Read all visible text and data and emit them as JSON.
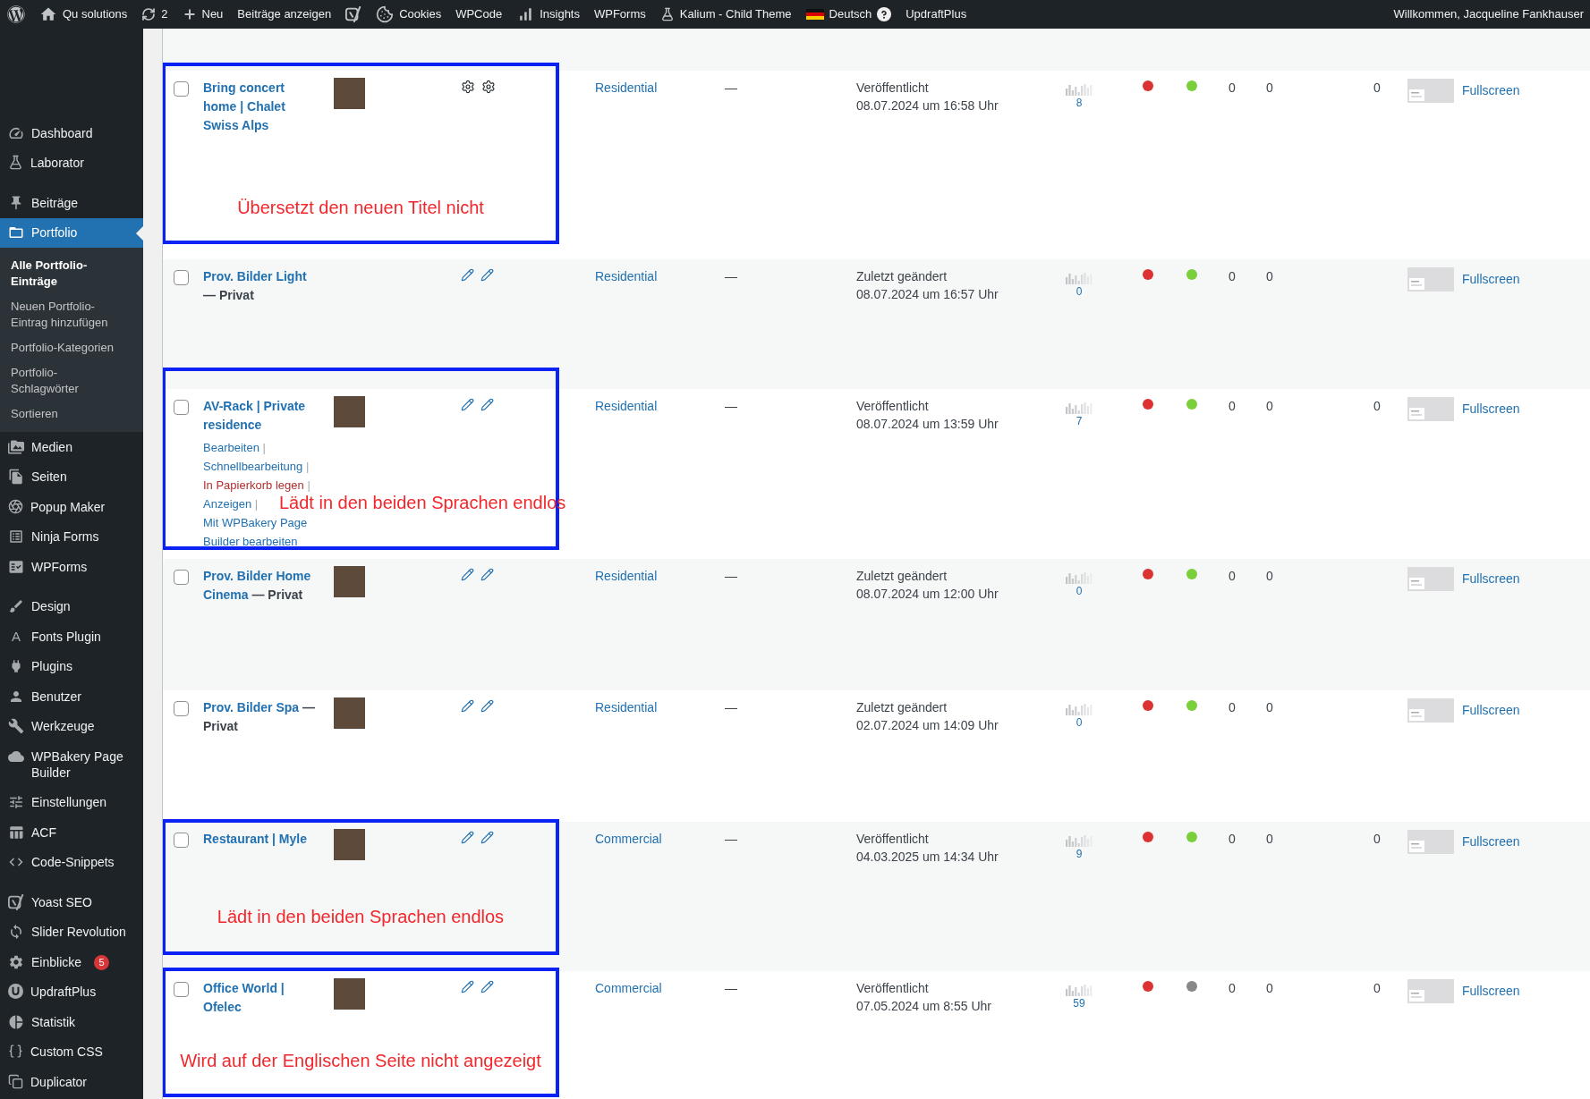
{
  "admin_bar": {
    "items": [
      {
        "kind": "wordpress"
      },
      {
        "kind": "home",
        "label": "Qu solutions"
      },
      {
        "kind": "updates",
        "label": "2"
      },
      {
        "kind": "new",
        "label": "Neu"
      },
      {
        "kind": "text",
        "label": "Beiträge anzeigen"
      },
      {
        "kind": "yoast"
      },
      {
        "kind": "cookie",
        "label": "Cookies"
      },
      {
        "kind": "text",
        "label": "WPCode"
      },
      {
        "kind": "chart",
        "label": "Insights"
      },
      {
        "kind": "text",
        "label": "WPForms"
      },
      {
        "kind": "flask",
        "label": "Kalium - Child Theme"
      },
      {
        "kind": "language",
        "label": "Deutsch"
      },
      {
        "kind": "text",
        "label": "UpdraftPlus"
      }
    ],
    "greeting": "Willkommen, Jacqueline Fankhauser"
  },
  "sidebar": {
    "groups": [
      {
        "items": [
          {
            "kind": "gauge",
            "label": "Dashboard",
            "selected": false
          },
          {
            "kind": "flask",
            "label": "Laborator",
            "selected": false
          }
        ]
      },
      {
        "items": [
          {
            "kind": "pin",
            "label": "Beiträge",
            "selected": false
          },
          {
            "kind": "folder",
            "label": "Portfolio",
            "selected": true,
            "children": [
              {
                "label": "Alle Portfolio-Einträge",
                "selected": true
              },
              {
                "label": "Neuen Portfolio-Eintrag hinzufügen",
                "selected": false
              },
              {
                "label": "Portfolio-Kategorien",
                "selected": false
              },
              {
                "label": "Portfolio-Schlagwörter",
                "selected": false
              },
              {
                "label": "Sortieren",
                "selected": false
              }
            ]
          },
          {
            "kind": "media",
            "label": "Medien",
            "selected": false
          },
          {
            "kind": "pages",
            "label": "Seiten",
            "selected": false
          },
          {
            "kind": "popup",
            "label": "Popup Maker",
            "selected": false
          },
          {
            "kind": "form",
            "label": "Ninja Forms",
            "selected": false
          },
          {
            "kind": "checklist",
            "label": "WPForms",
            "selected": false
          }
        ]
      },
      {
        "items": [
          {
            "kind": "brush",
            "label": "Design",
            "selected": false
          },
          {
            "kind": "glyph",
            "glyph": "A",
            "label": "Fonts Plugin",
            "selected": false
          },
          {
            "kind": "plug",
            "label": "Plugins",
            "selected": false
          },
          {
            "kind": "user",
            "label": "Benutzer",
            "selected": false
          },
          {
            "kind": "wrench",
            "label": "Werkzeuge",
            "selected": false
          },
          {
            "kind": "cloud",
            "label": "WPBakery Page Builder",
            "selected": false
          },
          {
            "kind": "sliders",
            "label": "Einstellungen",
            "selected": false
          },
          {
            "kind": "table",
            "label": "ACF",
            "selected": false
          },
          {
            "kind": "code",
            "label": "Code-Snippets",
            "selected": false
          }
        ]
      },
      {
        "items": [
          {
            "kind": "yoast",
            "label": "Yoast SEO",
            "selected": false
          },
          {
            "kind": "sync",
            "label": "Slider Revolution",
            "selected": false
          },
          {
            "kind": "gear",
            "label": "Einblicke",
            "selected": false,
            "badge": "5"
          },
          {
            "kind": "ulogo",
            "label": "UpdraftPlus",
            "selected": false
          },
          {
            "kind": "pie",
            "label": "Statistik",
            "selected": false
          },
          {
            "kind": "braces",
            "label": "Custom CSS",
            "selected": false
          },
          {
            "kind": "copy",
            "label": "Duplicator",
            "selected": false
          }
        ]
      }
    ]
  },
  "table": {
    "rows": [
      {
        "checked": false,
        "title": "Bring concert home | Chalet Swiss Alps",
        "thumbnail": true,
        "translation_icons": [
          {
            "kind": "gear"
          },
          {
            "kind": "gear"
          }
        ],
        "category": "Residential",
        "tags": "—",
        "date_status": "Veröffentlicht",
        "date": "08.07.2024 um 16:58 Uhr",
        "stats_count": "8",
        "status_dots": [
          {
            "color": "#dc3232"
          },
          {
            "color": "#7ad03a"
          }
        ],
        "counts": [
          "0",
          "0",
          "0"
        ],
        "preview_link": "Fullscreen",
        "annotation": "Übersetzt den neuen Titel nicht"
      },
      {
        "checked": false,
        "title": "Prov. Bilder Light",
        "post_state": "— Privat",
        "thumbnail": false,
        "translation_icons": [
          {
            "kind": "pencil"
          },
          {
            "kind": "pencil"
          }
        ],
        "category": "Residential",
        "tags": "—",
        "date_status": "Zuletzt geändert",
        "date": "08.07.2024 um 16:57 Uhr",
        "stats_count": "0",
        "status_dots": [
          {
            "color": "#dc3232"
          },
          {
            "color": "#7ad03a"
          }
        ],
        "counts": [
          "0",
          "0"
        ],
        "preview_link": "Fullscreen"
      },
      {
        "checked": false,
        "title": "AV-Rack | Private residence",
        "thumbnail": true,
        "row_actions": {
          "separator": "|",
          "items": [
            {
              "label": "Bearbeiten",
              "kind": "link"
            },
            {
              "label": "Schnellbearbeitung",
              "kind": "link"
            },
            {
              "label": "In Papierkorb legen",
              "kind": "delete"
            },
            {
              "label": "Anzeigen",
              "kind": "link"
            },
            {
              "label": "Mit WPBakery Page Builder bearbeiten",
              "kind": "link"
            }
          ]
        },
        "translation_icons": [
          {
            "kind": "pencil"
          },
          {
            "kind": "pencil"
          }
        ],
        "category": "Residential",
        "tags": "—",
        "date_status": "Veröffentlicht",
        "date": "08.07.2024 um 13:59 Uhr",
        "stats_count": "7",
        "status_dots": [
          {
            "color": "#dc3232"
          },
          {
            "color": "#7ad03a"
          }
        ],
        "counts": [
          "0",
          "0",
          "0"
        ],
        "preview_link": "Fullscreen",
        "annotation": "Lädt in den beiden Sprachen endlos"
      },
      {
        "checked": false,
        "title": "Prov. Bilder Home Cinema",
        "post_state": "— Privat",
        "thumbnail": true,
        "translation_icons": [
          {
            "kind": "pencil"
          },
          {
            "kind": "pencil"
          }
        ],
        "category": "Residential",
        "tags": "—",
        "date_status": "Zuletzt geändert",
        "date": "08.07.2024 um 12:00 Uhr",
        "stats_count": "0",
        "status_dots": [
          {
            "color": "#dc3232"
          },
          {
            "color": "#7ad03a"
          }
        ],
        "counts": [
          "0",
          "0"
        ],
        "preview_link": "Fullscreen"
      },
      {
        "checked": false,
        "title": "Prov. Bilder Spa",
        "post_state": "— Privat",
        "thumbnail": true,
        "translation_icons": [
          {
            "kind": "pencil"
          },
          {
            "kind": "pencil"
          }
        ],
        "category": "Residential",
        "tags": "—",
        "date_status": "Zuletzt geändert",
        "date": "02.07.2024 um 14:09 Uhr",
        "stats_count": "0",
        "status_dots": [
          {
            "color": "#dc3232"
          },
          {
            "color": "#7ad03a"
          }
        ],
        "counts": [
          "0",
          "0"
        ],
        "preview_link": "Fullscreen"
      },
      {
        "checked": false,
        "title": "Restaurant | Myle",
        "thumbnail": true,
        "translation_icons": [
          {
            "kind": "pencil"
          },
          {
            "kind": "pencil"
          }
        ],
        "category": "Commercial",
        "tags": "—",
        "date_status": "Veröffentlicht",
        "date": "04.03.2025 um 14:34 Uhr",
        "stats_count": "9",
        "status_dots": [
          {
            "color": "#dc3232"
          },
          {
            "color": "#7ad03a"
          }
        ],
        "counts": [
          "0",
          "0",
          "0"
        ],
        "preview_link": "Fullscreen",
        "annotation": "Lädt in den beiden Sprachen endlos"
      },
      {
        "checked": false,
        "title": "Office World | Ofelec",
        "thumbnail": true,
        "translation_icons": [
          {
            "kind": "pencil"
          },
          {
            "kind": "pencil"
          }
        ],
        "category": "Commercial",
        "tags": "—",
        "date_status": "Veröffentlicht",
        "date": "07.05.2024 um 8:55 Uhr",
        "stats_count": "59",
        "status_dots": [
          {
            "color": "#dc3232"
          },
          {
            "color": "#888888"
          }
        ],
        "counts": [
          "0",
          "0",
          "0"
        ],
        "preview_link": "Fullscreen",
        "annotation": "Wird auf der Englischen Seite nicht angezeigt"
      }
    ]
  }
}
